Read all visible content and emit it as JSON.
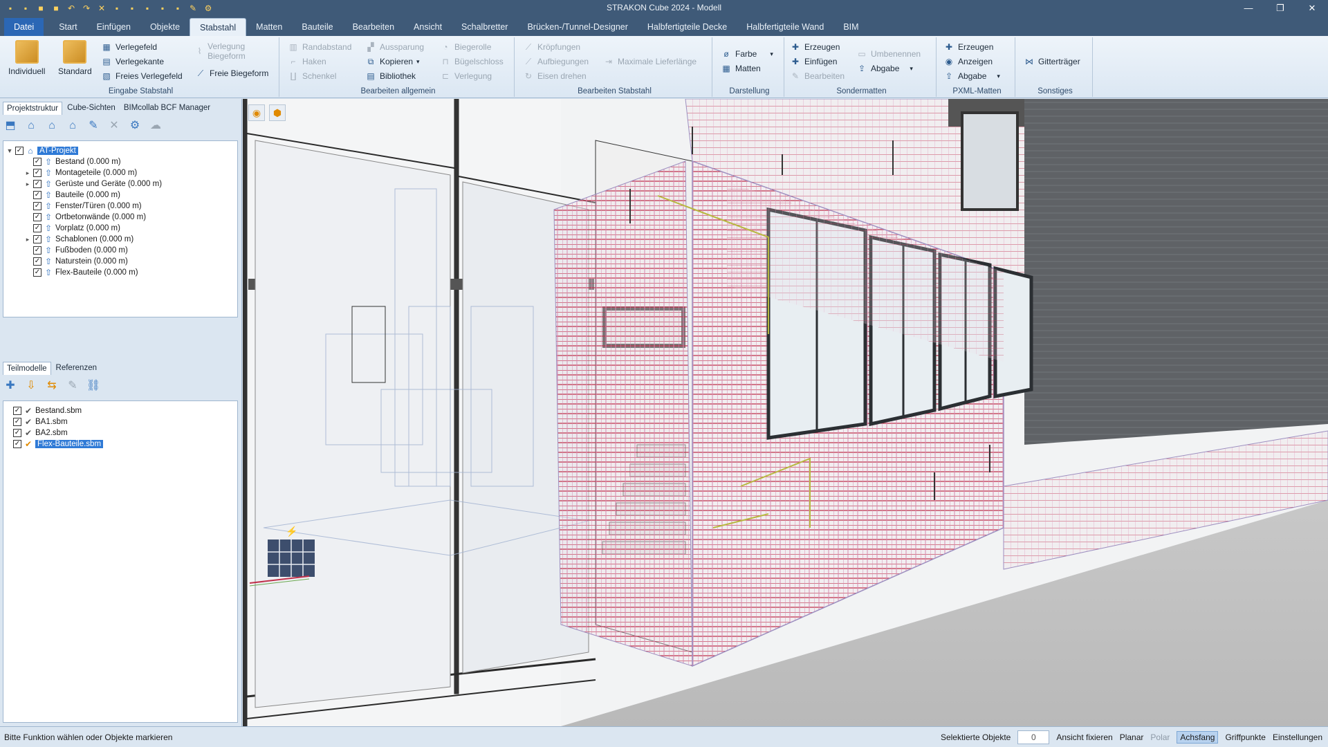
{
  "title": "STRAKON Cube 2024 - Modell",
  "window_controls": [
    "minimize",
    "restore",
    "close"
  ],
  "tabs": [
    "Datei",
    "Start",
    "Einfügen",
    "Objekte",
    "Stabstahl",
    "Matten",
    "Bauteile",
    "Bearbeiten",
    "Ansicht",
    "Schalbretter",
    "Brücken-/Tunnel-Designer",
    "Halbfertigteile Decke",
    "Halbfertigteile Wand",
    "BIM"
  ],
  "active_tab": "Stabstahl",
  "ribbon": {
    "eingabe": {
      "label": "Eingabe Stabstahl",
      "individuell": "Individuell",
      "standard": "Standard",
      "verlegefeld": "Verlegefeld",
      "verlegekante": "Verlegekante",
      "freies_verlegefeld": "Freies Verlegefeld",
      "verlegung_biegeform": "Verlegung Biegeform",
      "freie_biegeform": "Freie Biegeform"
    },
    "bearbeiten_allgemein": {
      "label": "Bearbeiten allgemein",
      "randabstand": "Randabstand",
      "haken": "Haken",
      "schenkel": "Schenkel",
      "aussparung": "Aussparung",
      "kopieren": "Kopieren",
      "bibliothek": "Bibliothek",
      "biegerolle": "Biegerolle",
      "buegelschloss": "Bügelschloss",
      "verlegung": "Verlegung"
    },
    "bearbeiten_stabstahl": {
      "label": "Bearbeiten Stabstahl",
      "kroepfungen": "Kröpfungen",
      "aufbiegungen": "Aufbiegungen",
      "eisen_drehen": "Eisen drehen",
      "maximale_lieferlaenge": "Maximale Lieferlänge"
    },
    "darstellung": {
      "label": "Darstellung",
      "farbe": "Farbe",
      "matten": "Matten"
    },
    "sondermatten": {
      "label": "Sondermatten",
      "erzeugen": "Erzeugen",
      "einfuegen": "Einfügen",
      "bearbeiten": "Bearbeiten",
      "umbenennen": "Umbenennen",
      "abgabe": "Abgabe"
    },
    "pxml": {
      "label": "PXML-Matten",
      "erzeugen": "Erzeugen",
      "anzeigen": "Anzeigen",
      "abgabe": "Abgabe"
    },
    "sonstiges": {
      "label": "Sonstiges",
      "gittertraeger": "Gitterträger"
    }
  },
  "project_panel": {
    "tabs": [
      "Projektstruktur",
      "Cube-Sichten",
      "BIMcollab BCF Manager"
    ],
    "root": "AT-Projekt",
    "items": [
      "Bestand (0.000 m)",
      "Montageteile (0.000 m)",
      "Gerüste und Geräte (0.000 m)",
      "Bauteile (0.000 m)",
      "Fenster/Türen (0.000 m)",
      "Ortbetonwände (0.000 m)",
      "Vorplatz (0.000 m)",
      "Schablonen (0.000 m)",
      "Fußboden (0.000 m)",
      "Naturstein (0.000 m)",
      "Flex-Bauteile (0.000 m)"
    ]
  },
  "submodel_panel": {
    "tabs": [
      "Teilmodelle",
      "Referenzen"
    ],
    "items": [
      "Bestand.sbm",
      "BA1.sbm",
      "BA2.sbm",
      "Flex-Bauteile.sbm"
    ],
    "selected": "Flex-Bauteile.sbm"
  },
  "statusbar": {
    "message": "Bitte Funktion wählen oder Objekte markieren",
    "selected_label": "Selektierte Objekte",
    "selected_count": "0",
    "ansicht_fixieren": "Ansicht fixieren",
    "planar": "Planar",
    "polar": "Polar",
    "achsfang": "Achsfang",
    "griffpunkte": "Griffpunkte",
    "einstellungen": "Einstellungen"
  },
  "colors": {
    "titlebar": "#3f5a78",
    "ribbon": "#dbe7f3",
    "rebar_red": "#c0304a",
    "rebar_pink": "#d889b0",
    "brick": "#6b6e72",
    "selection": "#2f7ad6"
  }
}
